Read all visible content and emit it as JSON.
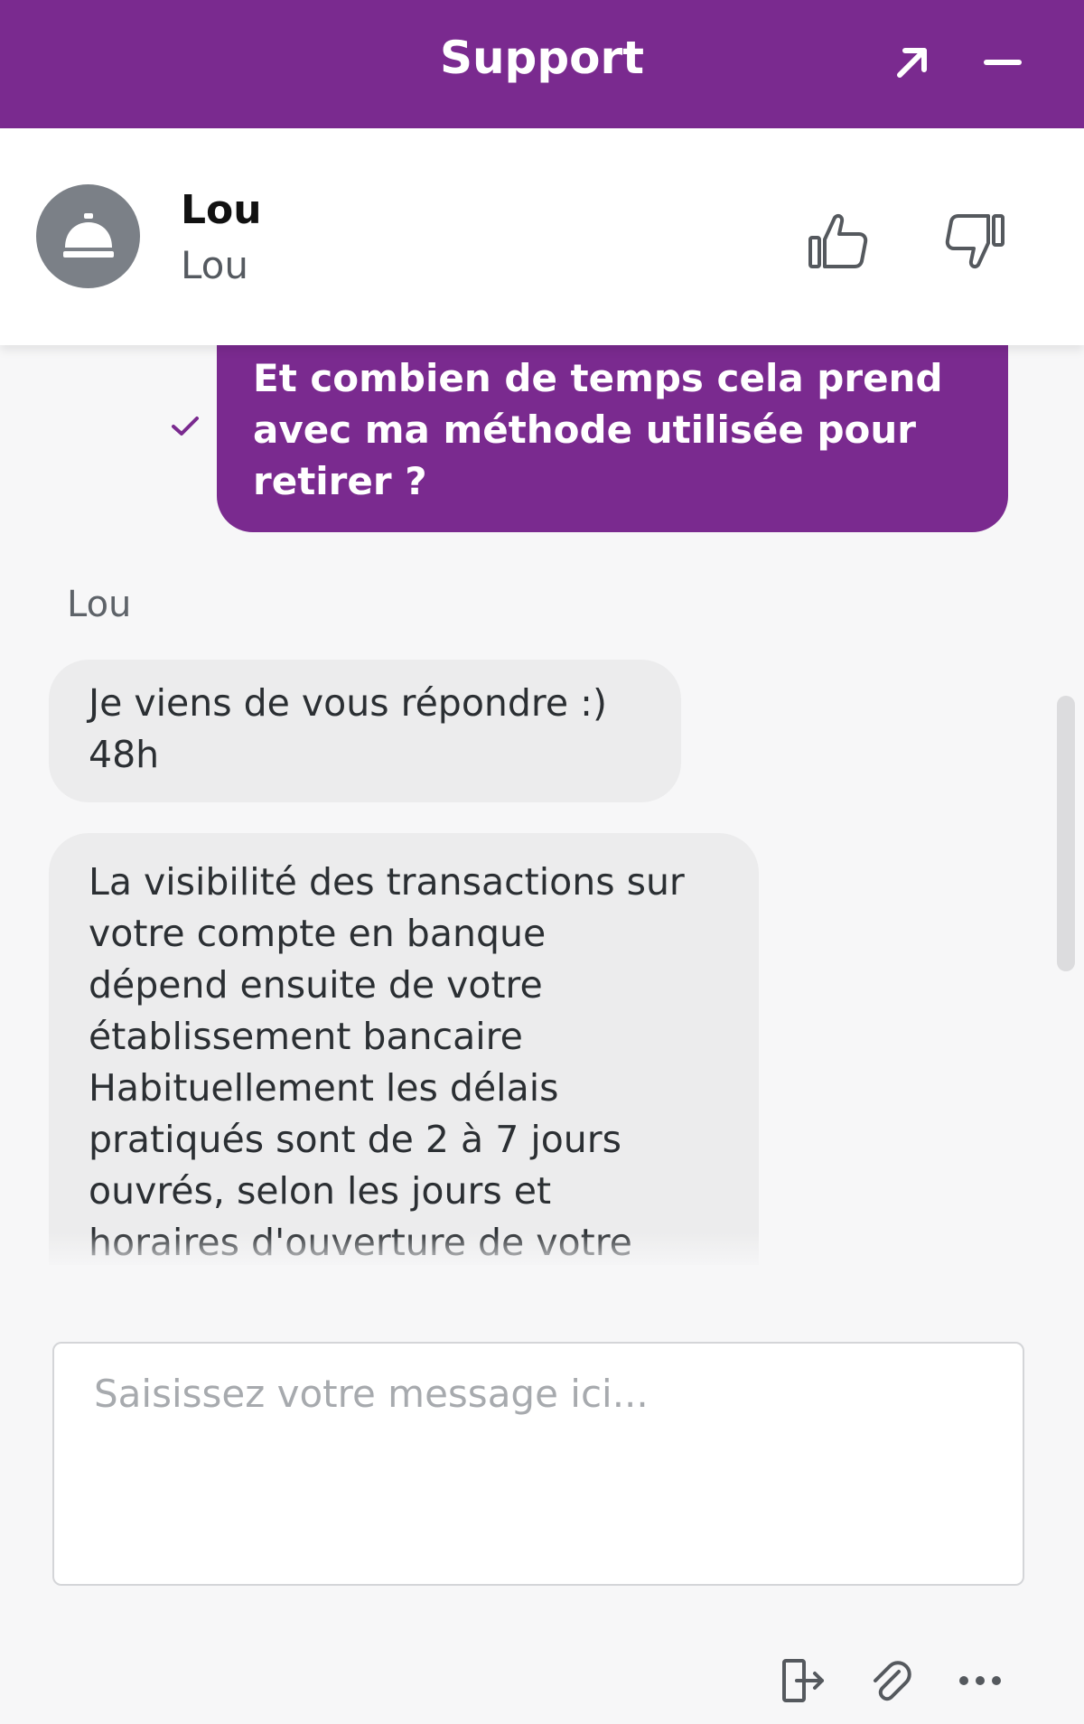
{
  "header": {
    "title": "Support",
    "icons": {
      "expand": "arrow-up-right-icon",
      "minimize": "minimize-icon"
    },
    "background_color": "#7a2a8f"
  },
  "agent": {
    "name": "Lou",
    "subtitle": "Lou",
    "avatar_icon": "service-bell-icon",
    "rating": {
      "up_icon": "thumbs-up-icon",
      "down_icon": "thumbs-down-icon"
    }
  },
  "conversation": {
    "outgoing": {
      "text": "Et combien de temps cela prend avec ma méthode utilisée pour retirer ?",
      "status_icon": "check-icon"
    },
    "incoming_sender": "Lou",
    "incoming": [
      {
        "text": "Je viens de vous répondre :)\n48h"
      },
      {
        "text": "La visibilité des transactions sur\nvotre compte en banque\ndépend ensuite de votre\nétablissement bancaire\nHabituellement les délais\npratiqués sont de 2 à 7 jours\nouvrés, selon les jours et\nhoraires d'ouverture de votre"
      }
    ],
    "bubble_colors": {
      "outgoing": "#7a2a8f",
      "incoming": "#ececed"
    }
  },
  "composer": {
    "placeholder": "Saisissez votre message ici..."
  },
  "toolbar": {
    "icons": [
      "exit-chat-icon",
      "paperclip-icon",
      "more-options-icon"
    ]
  }
}
